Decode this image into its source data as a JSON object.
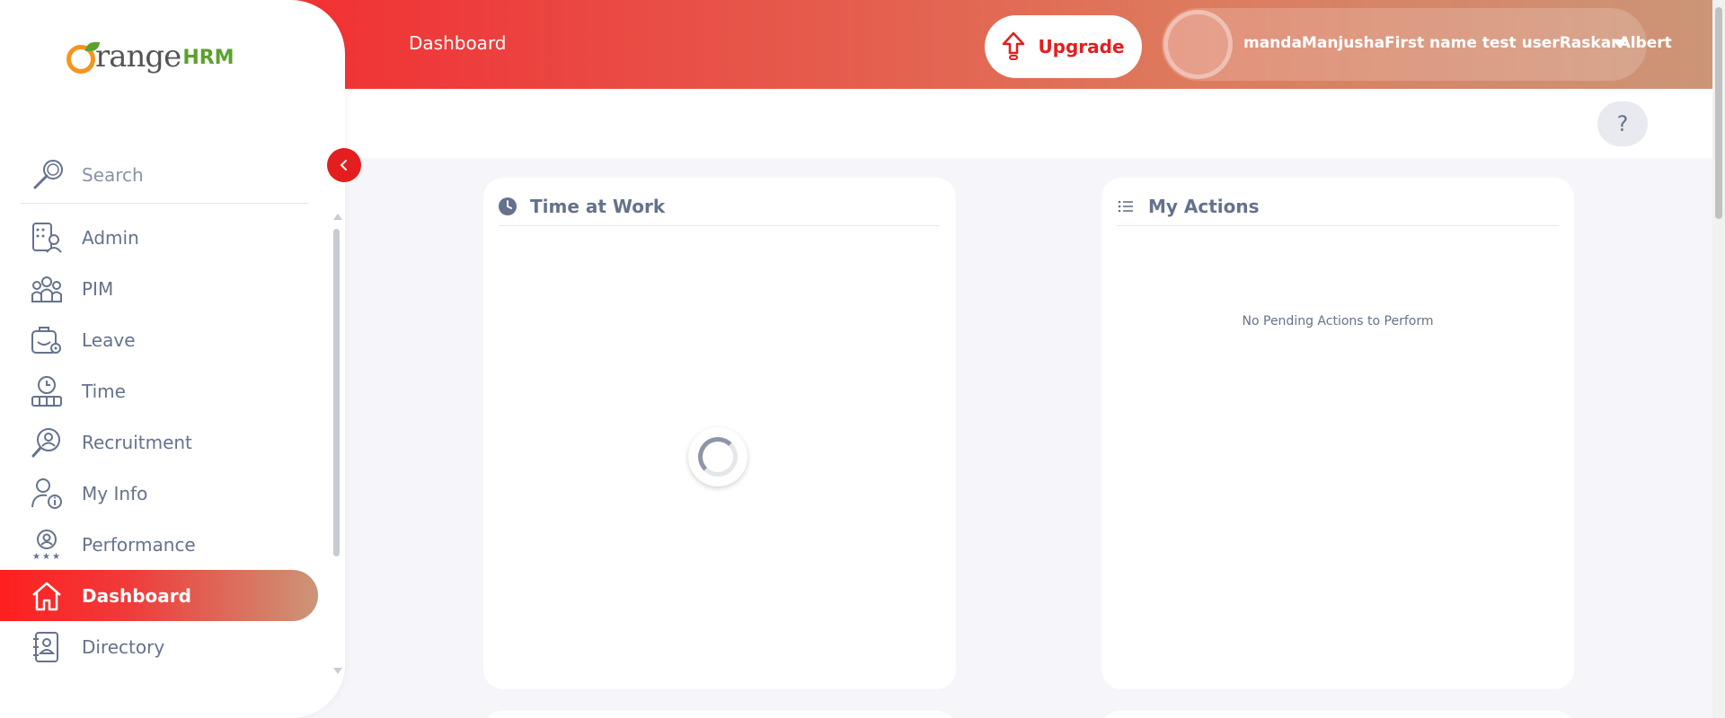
{
  "app": {
    "logo_text_main": "range",
    "logo_text_brand": "HRM"
  },
  "topbar": {
    "title": "Dashboard",
    "upgrade_label": "Upgrade",
    "user_name": "mandaManjushaFirst name test userRaskarAlbert"
  },
  "help": {
    "label": "?"
  },
  "sidebar": {
    "search_label": "Search",
    "items": [
      {
        "label": "Admin",
        "icon": "admin-icon"
      },
      {
        "label": "PIM",
        "icon": "pim-icon"
      },
      {
        "label": "Leave",
        "icon": "leave-icon"
      },
      {
        "label": "Time",
        "icon": "time-icon"
      },
      {
        "label": "Recruitment",
        "icon": "recruitment-icon"
      },
      {
        "label": "My Info",
        "icon": "my-info-icon"
      },
      {
        "label": "Performance",
        "icon": "performance-icon"
      },
      {
        "label": "Dashboard",
        "icon": "dashboard-icon",
        "active": true
      },
      {
        "label": "Directory",
        "icon": "directory-icon"
      }
    ]
  },
  "widgets": {
    "time_at_work": {
      "title": "Time at Work",
      "icon": "clock-icon"
    },
    "my_actions": {
      "title": "My Actions",
      "icon": "list-icon",
      "empty_text": "No Pending Actions to Perform"
    }
  },
  "colors": {
    "accent": "#e41e1e",
    "gradient_start": "#ff1f1f",
    "gradient_end": "#cc9577",
    "text": "#64728c"
  }
}
